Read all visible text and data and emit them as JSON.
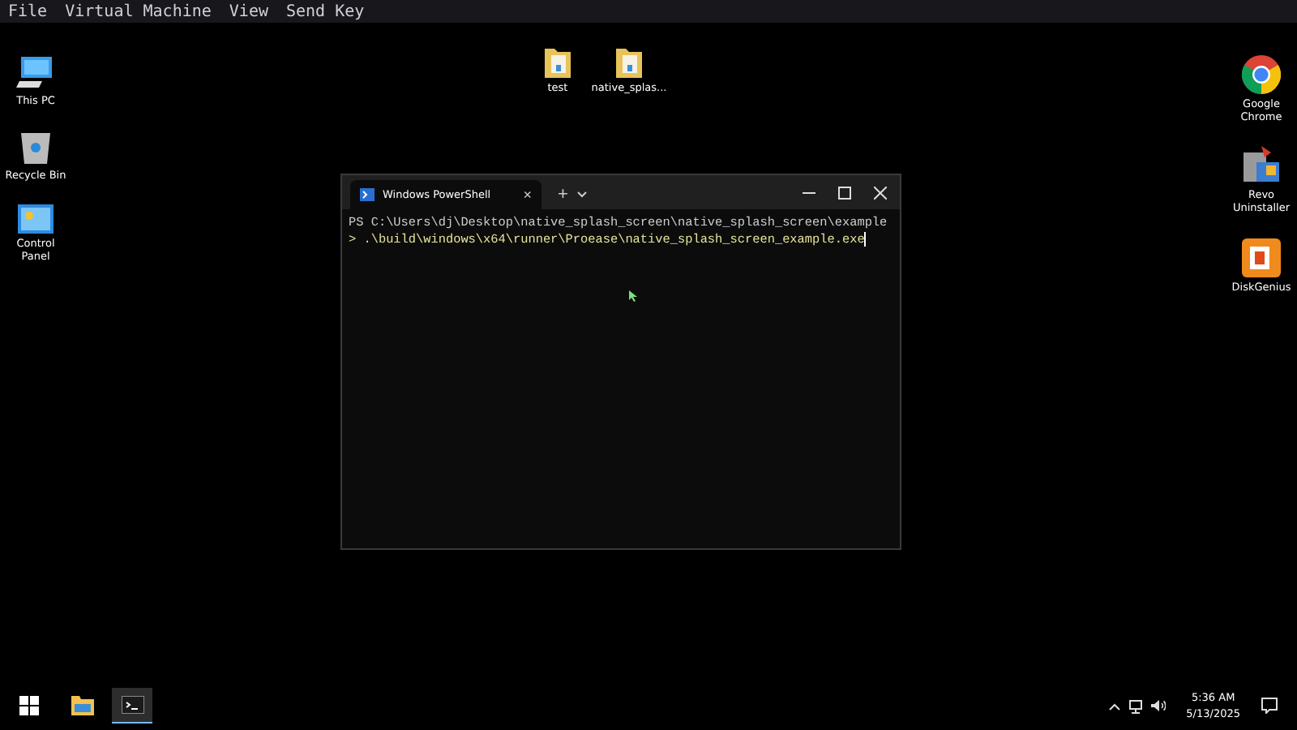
{
  "menu_bar": [
    "File",
    "Virtual Machine",
    "View",
    "Send Key"
  ],
  "desktop": {
    "left_icons": [
      {
        "label": "This PC",
        "kind": "pc"
      },
      {
        "label": "Recycle Bin",
        "kind": "bin"
      },
      {
        "label": "Control Panel",
        "kind": "control"
      }
    ],
    "center_icons": [
      {
        "label": "test",
        "kind": "folder"
      },
      {
        "label": "native_splas...",
        "kind": "folder"
      }
    ],
    "right_icons": [
      {
        "label": "Google Chrome",
        "kind": "chrome"
      },
      {
        "label": "Revo Uninstaller",
        "kind": "revo"
      },
      {
        "label": "DiskGenius",
        "kind": "disk"
      }
    ]
  },
  "terminal": {
    "tab_title": "Windows PowerShell",
    "tab_close": "×",
    "new_tab": "+",
    "lines": [
      "PS C:\\Users\\dj\\Desktop\\native_splash_screen\\native_splash_screen\\example",
      "> .\\build\\windows\\x64\\runner\\Proease\\native_splash_screen_example.exe"
    ]
  },
  "taskbar": {
    "apps": [
      {
        "kind": "start",
        "selected": false
      },
      {
        "kind": "explorer",
        "selected": false
      },
      {
        "kind": "terminal",
        "selected": true
      }
    ],
    "time": "5:36 AM",
    "date": "5/13/2025"
  }
}
